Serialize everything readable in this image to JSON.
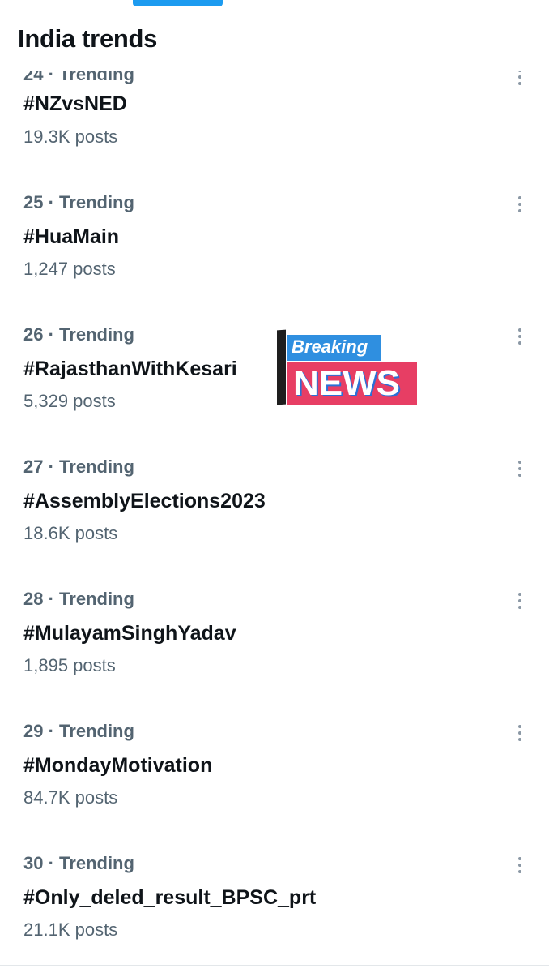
{
  "header": {
    "title": "India trends"
  },
  "trends": [
    {
      "rank": "24",
      "label": "Trending",
      "hashtag": "#NZvsNED",
      "posts": "19.3K posts"
    },
    {
      "rank": "25",
      "label": "Trending",
      "hashtag": "#HuaMain",
      "posts": "1,247 posts"
    },
    {
      "rank": "26",
      "label": "Trending",
      "hashtag": "#RajasthanWithKesari",
      "posts": "5,329 posts"
    },
    {
      "rank": "27",
      "label": "Trending",
      "hashtag": "#AssemblyElections2023",
      "posts": "18.6K posts"
    },
    {
      "rank": "28",
      "label": "Trending",
      "hashtag": "#MulayamSinghYadav",
      "posts": "1,895 posts"
    },
    {
      "rank": "29",
      "label": "Trending",
      "hashtag": "#MondayMotivation",
      "posts": "84.7K posts"
    },
    {
      "rank": "30",
      "label": "Trending",
      "hashtag": "#Only_deled_result_BPSC_prt",
      "posts": "21.1K posts"
    }
  ],
  "overlay": {
    "top_text": "Breaking",
    "bottom_text": "NEWS"
  },
  "icons": {
    "more": "more-vertical-icon"
  },
  "colors": {
    "accent": "#1d9bf0",
    "text_primary": "#0f1419",
    "text_secondary": "#536471",
    "breaking_blue": "#2f8fe0",
    "breaking_red": "#e73e64"
  }
}
